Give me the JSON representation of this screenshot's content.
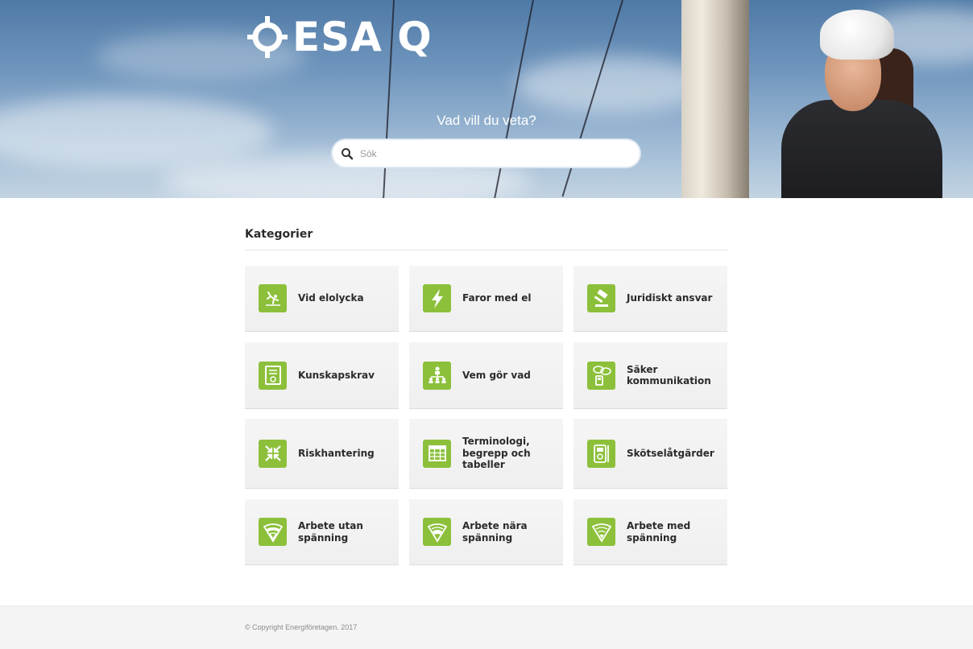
{
  "brand": {
    "logo_text": "ESA Q"
  },
  "hero": {
    "question": "Vad vill du veta?",
    "search_placeholder": "Sök"
  },
  "categories": {
    "title": "Kategorier",
    "items": [
      {
        "label": "Vid elolycka",
        "icon": "falling-person-icon"
      },
      {
        "label": "Faror med el",
        "icon": "lightning-bolt-icon"
      },
      {
        "label": "Juridiskt ansvar",
        "icon": "gavel-icon"
      },
      {
        "label": "Kunskapskrav",
        "icon": "certificate-icon"
      },
      {
        "label": "Vem gör vad",
        "icon": "org-chart-icon"
      },
      {
        "label": "Säker kommunikation",
        "icon": "walkie-talkie-icon"
      },
      {
        "label": "Riskhantering",
        "icon": "compress-arrows-icon"
      },
      {
        "label": "Terminologi, begrepp och tabeller",
        "icon": "table-icon"
      },
      {
        "label": "Skötselåtgärder",
        "icon": "multimeter-icon"
      },
      {
        "label": "Arbete utan spänning",
        "icon": "zone-outer-icon"
      },
      {
        "label": "Arbete nära spänning",
        "icon": "zone-middle-icon"
      },
      {
        "label": "Arbete med spänning",
        "icon": "zone-inner-icon"
      }
    ]
  },
  "footer": {
    "copyright": "© Copyright Energiföretagen. 2017"
  },
  "colors": {
    "accent": "#8cc03b",
    "text": "#2b2b2b",
    "card_bg": "#f3f3f3"
  }
}
